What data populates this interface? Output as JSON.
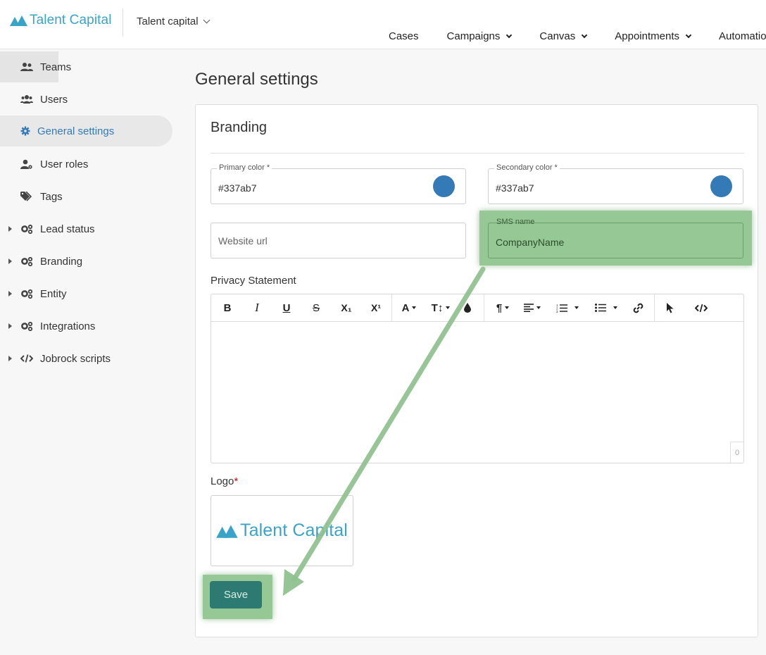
{
  "header": {
    "logo_text": "Talent Capital",
    "org_selector": "Talent capital",
    "nav": [
      {
        "label": "Cases",
        "has_dropdown": false
      },
      {
        "label": "Campaigns",
        "has_dropdown": true
      },
      {
        "label": "Canvas",
        "has_dropdown": true
      },
      {
        "label": "Appointments",
        "has_dropdown": true
      },
      {
        "label": "Automatio",
        "has_dropdown": false
      }
    ]
  },
  "sidebar": {
    "items": [
      {
        "label": "Teams",
        "icon": "teams-icon",
        "expandable": false
      },
      {
        "label": "Users",
        "icon": "users-icon",
        "expandable": false
      },
      {
        "label": "General settings",
        "icon": "gear-icon",
        "expandable": false,
        "active": true
      },
      {
        "label": "User roles",
        "icon": "user-roles-icon",
        "expandable": false
      },
      {
        "label": "Tags",
        "icon": "tags-icon",
        "expandable": false
      },
      {
        "label": "Lead status",
        "icon": "gears-icon",
        "expandable": true
      },
      {
        "label": "Branding",
        "icon": "gears-icon",
        "expandable": true
      },
      {
        "label": "Entity",
        "icon": "gears-icon",
        "expandable": true
      },
      {
        "label": "Integrations",
        "icon": "gears-icon",
        "expandable": true
      },
      {
        "label": "Jobrock scripts",
        "icon": "code-icon",
        "expandable": true
      }
    ]
  },
  "main": {
    "title": "General settings",
    "card_title": "Branding",
    "fields": {
      "primary_color": {
        "label": "Primary color *",
        "value": "#337ab7",
        "swatch": "#337ab7"
      },
      "secondary_color": {
        "label": "Secondary color *",
        "value": "#337ab7",
        "swatch": "#337ab7"
      },
      "website_url": {
        "placeholder": "Website url",
        "value": ""
      },
      "sms_name": {
        "label": "SMS name",
        "value": "CompanyName"
      }
    },
    "privacy_label": "Privacy Statement",
    "editor": {
      "toolbar": [
        "B",
        "I",
        "U",
        "S",
        "X₁",
        "X¹",
        "A",
        "T↕",
        "drop",
        "¶",
        "align",
        "ol",
        "ul",
        "link",
        "pointer",
        "code"
      ],
      "char_count": "0"
    },
    "logo_label": "Logo",
    "logo_required": "*",
    "logo_preview_text": "Talent Capital",
    "save_label": "Save"
  },
  "colors": {
    "brand": "#3aa3c8",
    "accent": "#337ab7",
    "save_button": "#2d7a72",
    "highlight": "#8fc18f"
  }
}
